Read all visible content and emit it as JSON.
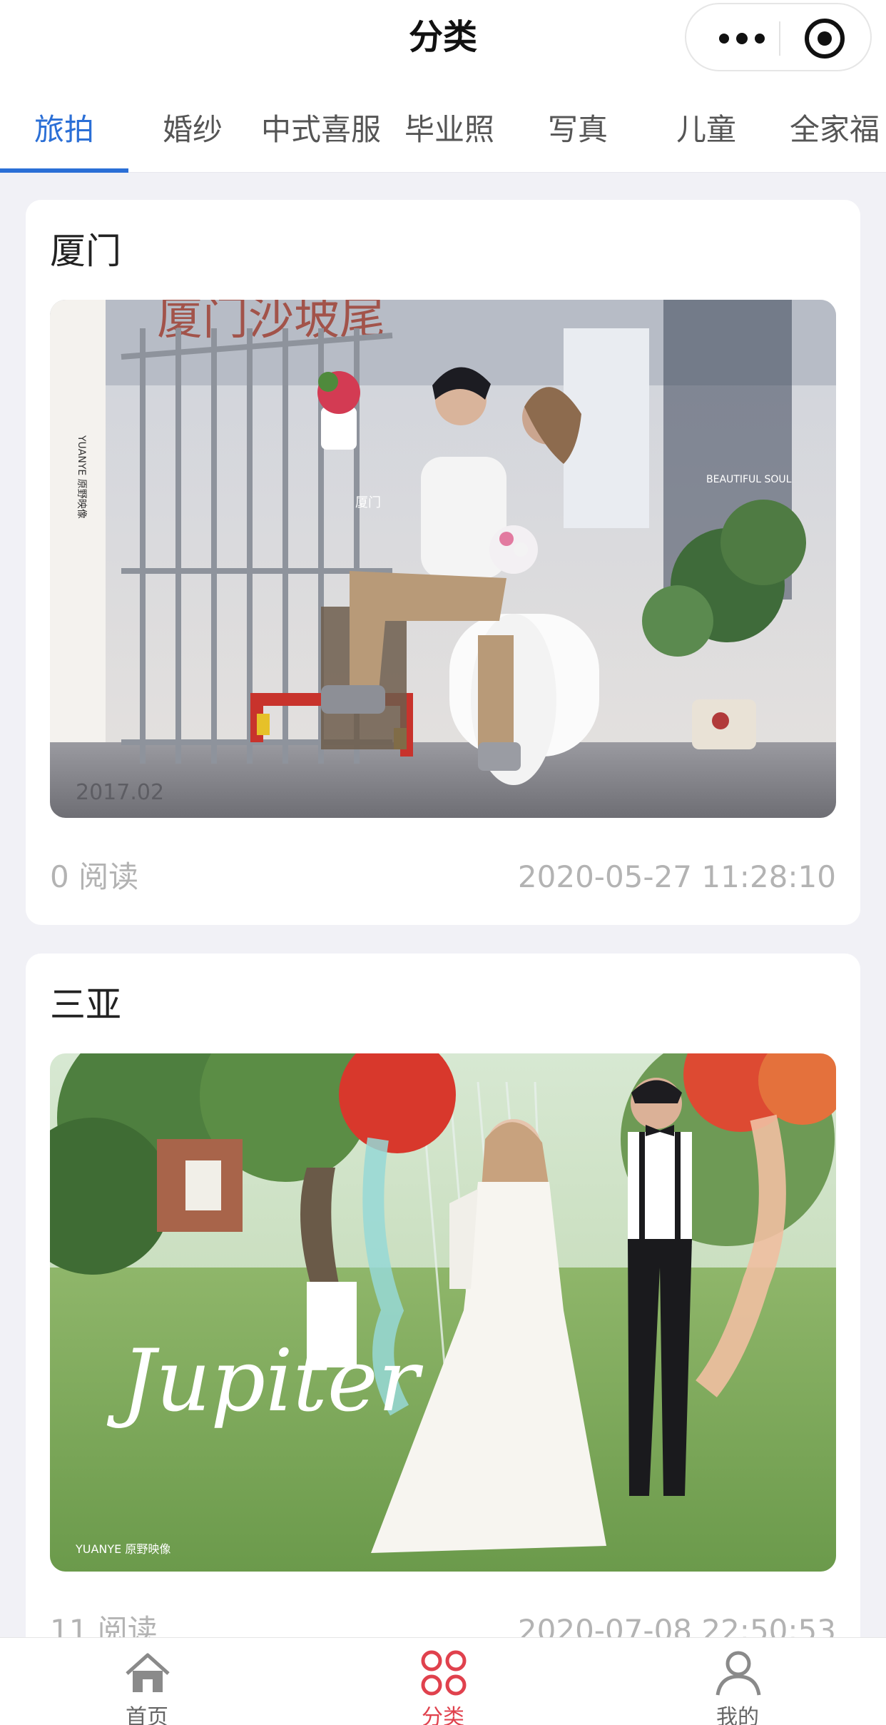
{
  "header": {
    "title": "分类"
  },
  "tabs": [
    {
      "label": "旅拍",
      "active": true
    },
    {
      "label": "婚纱"
    },
    {
      "label": "中式喜服"
    },
    {
      "label": "毕业照"
    },
    {
      "label": "写真"
    },
    {
      "label": "儿童"
    },
    {
      "label": "全家福"
    }
  ],
  "posts": [
    {
      "title": "厦门",
      "reads": "0 阅读",
      "time": "2020-05-27 11:28:10",
      "photo": {
        "brand": "YUANYE 原野映像",
        "caption": "厦门",
        "subtitle": "BEAUTIFUL SOUL",
        "year": "2017.02"
      }
    },
    {
      "title": "三亚",
      "reads": "11 阅读",
      "time": "2020-07-08 22:50:53",
      "photo": {
        "script": "Jupiter",
        "brand": "YUANYE 原野映像"
      }
    }
  ],
  "bottom_nav": [
    {
      "label": "首页",
      "icon": "home-icon"
    },
    {
      "label": "分类",
      "icon": "category-grid-icon",
      "active": true
    },
    {
      "label": "我的",
      "icon": "profile-icon"
    }
  ],
  "colors": {
    "accent": "#2b6fd6",
    "nav_active": "#e0414d",
    "meta": "#b3b3b3"
  }
}
